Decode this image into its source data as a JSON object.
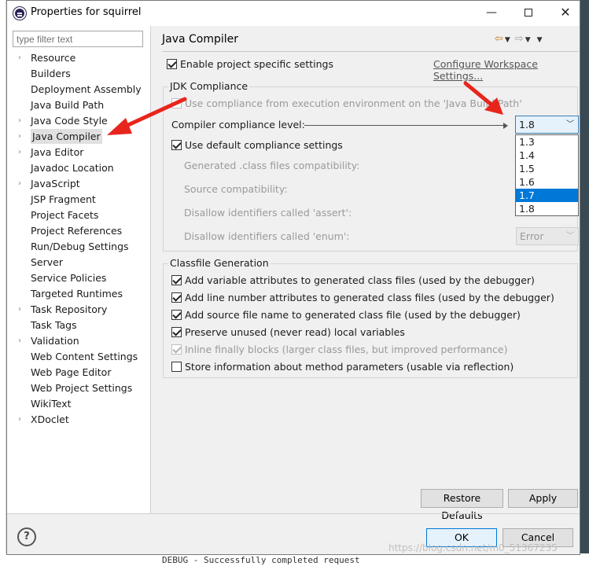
{
  "window": {
    "title": "Properties for squirrel",
    "minimize": "—",
    "close": "✕"
  },
  "filter": {
    "placeholder": "type filter text"
  },
  "tree": {
    "items": [
      {
        "label": "Resource",
        "expandable": true
      },
      {
        "label": "Builders",
        "expandable": false
      },
      {
        "label": "Deployment Assembly",
        "expandable": false
      },
      {
        "label": "Java Build Path",
        "expandable": false
      },
      {
        "label": "Java Code Style",
        "expandable": true
      },
      {
        "label": "Java Compiler",
        "expandable": true,
        "selected": true
      },
      {
        "label": "Java Editor",
        "expandable": true
      },
      {
        "label": "Javadoc Location",
        "expandable": false
      },
      {
        "label": "JavaScript",
        "expandable": true
      },
      {
        "label": "JSP Fragment",
        "expandable": false
      },
      {
        "label": "Project Facets",
        "expandable": false
      },
      {
        "label": "Project References",
        "expandable": false
      },
      {
        "label": "Run/Debug Settings",
        "expandable": false
      },
      {
        "label": "Server",
        "expandable": false
      },
      {
        "label": "Service Policies",
        "expandable": false
      },
      {
        "label": "Targeted Runtimes",
        "expandable": false
      },
      {
        "label": "Task Repository",
        "expandable": true
      },
      {
        "label": "Task Tags",
        "expandable": false
      },
      {
        "label": "Validation",
        "expandable": true
      },
      {
        "label": "Web Content Settings",
        "expandable": false
      },
      {
        "label": "Web Page Editor",
        "expandable": false
      },
      {
        "label": "Web Project Settings",
        "expandable": false
      },
      {
        "label": "WikiText",
        "expandable": false
      },
      {
        "label": "XDoclet",
        "expandable": true
      }
    ]
  },
  "page": {
    "title": "Java Compiler",
    "enable_specific": "Enable project specific settings",
    "configure_link": "Configure Workspace Settings..."
  },
  "jdk": {
    "group_label": "JDK Compliance",
    "use_exec_env": "Use compliance from execution environment on the 'Java Build Path'",
    "compliance_label": "Compiler compliance level:",
    "compliance_value": "1.8",
    "options": [
      "1.3",
      "1.4",
      "1.5",
      "1.6",
      "1.7",
      "1.8"
    ],
    "highlighted_option": "1.7",
    "use_default": "Use default compliance settings",
    "generated_compat": "Generated .class files compatibility:",
    "source_compat": "Source compatibility:",
    "disallow_assert": "Disallow identifiers called 'assert':",
    "disallow_enum": "Disallow identifiers called 'enum':",
    "enum_value": "Error"
  },
  "classfile": {
    "group_label": "Classfile Generation",
    "items": [
      {
        "label": "Add variable attributes to generated class files (used by the debugger)",
        "checked": true,
        "enabled": true
      },
      {
        "label": "Add line number attributes to generated class files (used by the debugger)",
        "checked": true,
        "enabled": true
      },
      {
        "label": "Add source file name to generated class file (used by the debugger)",
        "checked": true,
        "enabled": true
      },
      {
        "label": "Preserve unused (never read) local variables",
        "checked": true,
        "enabled": true
      },
      {
        "label": "Inline finally blocks (larger class files, but improved performance)",
        "checked": true,
        "enabled": false
      },
      {
        "label": "Store information about method parameters (usable via reflection)",
        "checked": false,
        "enabled": true
      }
    ]
  },
  "buttons": {
    "restore_defaults": "Restore Defaults",
    "apply": "Apply",
    "ok": "OK",
    "cancel": "Cancel",
    "help": "?"
  },
  "background": {
    "console_line": "DEBUG - Successfully completed request",
    "watermark": "https://blog.csdn.net/m0_51367235"
  },
  "colors": {
    "annotation_arrow": "#e8251c",
    "selection": "#0078d7"
  }
}
